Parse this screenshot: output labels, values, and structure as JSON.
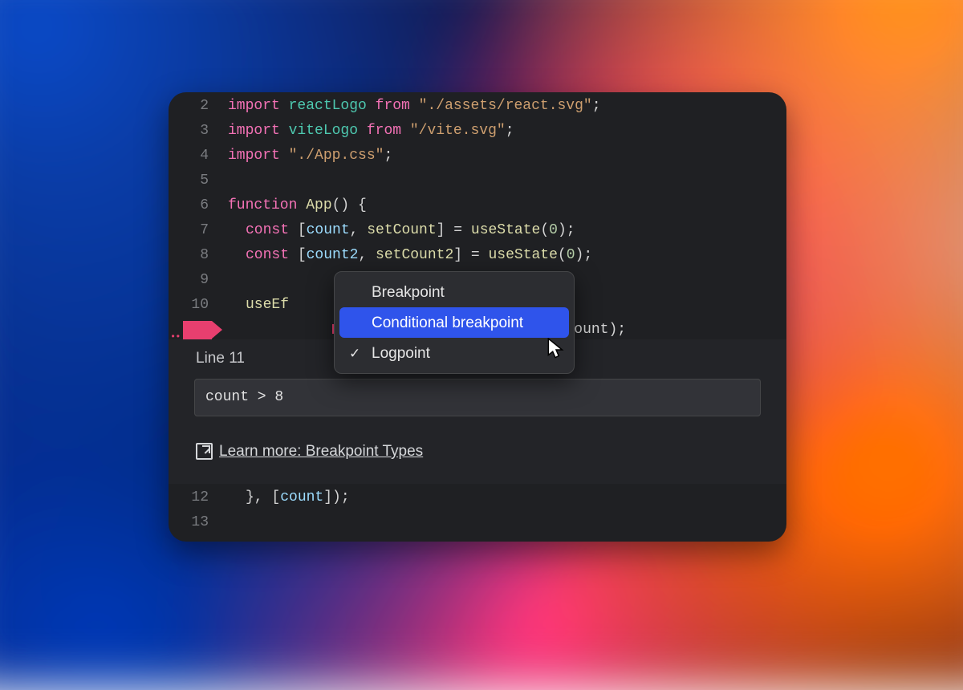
{
  "lines": {
    "2": {
      "n": "2",
      "tokens": [
        [
          "kw",
          "import "
        ],
        [
          "ident",
          "reactLogo "
        ],
        [
          "kw",
          "from "
        ],
        [
          "str",
          "\"./assets/react.svg\""
        ],
        [
          "punct",
          ";"
        ]
      ]
    },
    "3": {
      "n": "3",
      "tokens": [
        [
          "kw",
          "import "
        ],
        [
          "ident",
          "viteLogo "
        ],
        [
          "kw",
          "from "
        ],
        [
          "str",
          "\"/vite.svg\""
        ],
        [
          "punct",
          ";"
        ]
      ]
    },
    "4": {
      "n": "4",
      "tokens": [
        [
          "kw",
          "import "
        ],
        [
          "str",
          "\"./App.css\""
        ],
        [
          "punct",
          ";"
        ]
      ]
    },
    "5": {
      "n": "5",
      "tokens": []
    },
    "6": {
      "n": "6",
      "tokens": [
        [
          "kw",
          "function "
        ],
        [
          "fn",
          "App"
        ],
        [
          "punct",
          "() {"
        ]
      ]
    },
    "7": {
      "n": "7",
      "tokens": [
        [
          "kw",
          "const "
        ],
        [
          "punct",
          "["
        ],
        [
          "var",
          "count"
        ],
        [
          "punct",
          ", "
        ],
        [
          "fn",
          "setCount"
        ],
        [
          "punct",
          "] = "
        ],
        [
          "fn",
          "useState"
        ],
        [
          "punct",
          "("
        ],
        [
          "num",
          "0"
        ],
        [
          "punct",
          ");"
        ]
      ]
    },
    "8": {
      "n": "8",
      "tokens": [
        [
          "kw",
          "const "
        ],
        [
          "punct",
          "["
        ],
        [
          "var",
          "count2"
        ],
        [
          "punct",
          ", "
        ],
        [
          "fn",
          "setCount2"
        ],
        [
          "punct",
          "] = "
        ],
        [
          "fn",
          "useState"
        ],
        [
          "punct",
          "("
        ],
        [
          "num",
          "0"
        ],
        [
          "punct",
          ");"
        ]
      ]
    },
    "9": {
      "n": "9",
      "tokens": []
    },
    "10": {
      "n": "10",
      "tokens": [
        [
          "fn",
          "useEf"
        ]
      ]
    },
    "11": {
      "n": "11",
      "tokens_left": [
        [
          "punct",
          "co"
        ]
      ],
      "tokens_right": [
        [
          "punct",
          "ount);"
        ]
      ]
    },
    "12": {
      "n": "12",
      "tokens": [
        [
          "punct",
          "}, ["
        ],
        [
          "var",
          "count"
        ],
        [
          "punct",
          "]);"
        ]
      ]
    },
    "13": {
      "n": "13",
      "tokens": []
    }
  },
  "popup": {
    "items": [
      {
        "label": "Breakpoint",
        "checked": false,
        "selected": false
      },
      {
        "label": "Conditional breakpoint",
        "checked": false,
        "selected": true
      },
      {
        "label": "Logpoint",
        "checked": true,
        "selected": false
      }
    ]
  },
  "logpoint": {
    "heading": "Line 11",
    "value": "count > 8",
    "learn_more": "Learn more: Breakpoint Types"
  }
}
